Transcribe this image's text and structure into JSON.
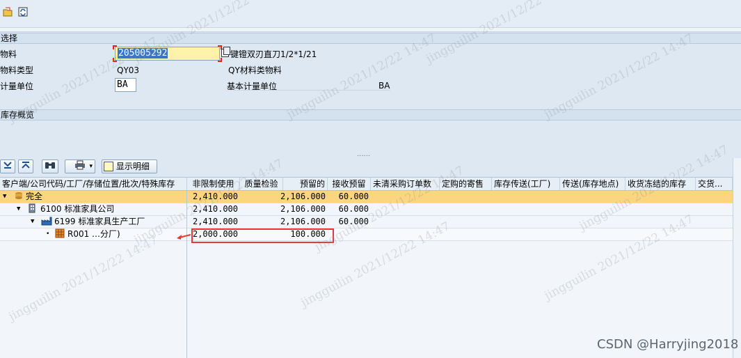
{
  "toolbar": {
    "icons": [
      "open-icon",
      "refresh-icon"
    ]
  },
  "selection": {
    "header": "选择",
    "material_label": "物料",
    "material_value": "205005292",
    "material_desc": "键镫双刃直刀1/2*1/21",
    "material_type_label": "物料类型",
    "material_type_value": "QY03",
    "material_type_desc": "QY材料类物料",
    "unit_label": "计量单位",
    "unit_value": "BA",
    "base_unit_label": "基本计量单位",
    "base_unit_value": "BA"
  },
  "stock_overview": {
    "header": "库存概览",
    "splitter_dots": "......",
    "show_details_label": "显示明细"
  },
  "grid": {
    "columns": [
      "客户端/公司代码/工厂/存储位置/批次/特殊库存",
      "非限制使用",
      "质量检验",
      "预留的",
      "接收预留",
      "未清采购订单数",
      "定购的寄售",
      "库存传送(工厂)",
      "传送(库存地点)",
      "收货冻结的库存",
      "交货..."
    ],
    "rows": [
      {
        "label": "完全",
        "unrestricted": "2,410.000",
        "reserved": "2,106.000",
        "receipt_reserved": "60.000"
      },
      {
        "label": "6100 标准家具公司",
        "unrestricted": "2,410.000",
        "reserved": "2,106.000",
        "receipt_reserved": "60.000"
      },
      {
        "label": "6199 标准家具生产工厂",
        "unrestricted": "2,410.000",
        "reserved": "2,106.000",
        "receipt_reserved": "60.000"
      },
      {
        "label": "R001 …分厂)",
        "unrestricted": "2,000.000",
        "reserved": "100.000",
        "receipt_reserved": ""
      }
    ]
  },
  "watermarks": {
    "user": "jingguilin 2021/12/22 14:47",
    "csdn": "CSDN @Harryjing2018"
  },
  "colors": {
    "highlight_row": "#fbd57f",
    "selected_row": "#f7f9fc",
    "annotation_red": "#e53935",
    "input_yellow": "#fdf3a9"
  }
}
